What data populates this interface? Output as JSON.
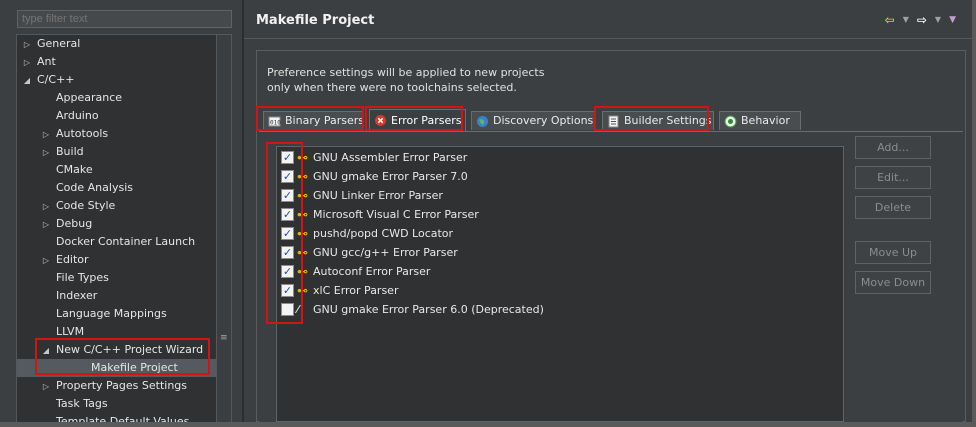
{
  "filter": {
    "placeholder": "type filter text"
  },
  "tree": [
    {
      "label": "General",
      "twisty": "collapsed",
      "indent": 0
    },
    {
      "label": "Ant",
      "twisty": "collapsed",
      "indent": 0
    },
    {
      "label": "C/C++",
      "twisty": "expanded",
      "indent": 0
    },
    {
      "label": "Appearance",
      "twisty": "none",
      "indent": 1
    },
    {
      "label": "Arduino",
      "twisty": "none",
      "indent": 1
    },
    {
      "label": "Autotools",
      "twisty": "collapsed",
      "indent": 1
    },
    {
      "label": "Build",
      "twisty": "collapsed",
      "indent": 1
    },
    {
      "label": "CMake",
      "twisty": "none",
      "indent": 1
    },
    {
      "label": "Code Analysis",
      "twisty": "none",
      "indent": 1
    },
    {
      "label": "Code Style",
      "twisty": "collapsed",
      "indent": 1
    },
    {
      "label": "Debug",
      "twisty": "collapsed",
      "indent": 1
    },
    {
      "label": "Docker Container Launch",
      "twisty": "none",
      "indent": 1
    },
    {
      "label": "Editor",
      "twisty": "collapsed",
      "indent": 1
    },
    {
      "label": "File Types",
      "twisty": "none",
      "indent": 1
    },
    {
      "label": "Indexer",
      "twisty": "none",
      "indent": 1
    },
    {
      "label": "Language Mappings",
      "twisty": "none",
      "indent": 1
    },
    {
      "label": "LLVM",
      "twisty": "none",
      "indent": 1
    },
    {
      "label": "New C/C++ Project Wizard",
      "twisty": "expanded",
      "indent": 1
    },
    {
      "label": "Makefile Project",
      "twisty": "none",
      "indent": 2,
      "selected": true
    },
    {
      "label": "Property Pages Settings",
      "twisty": "collapsed",
      "indent": 1
    },
    {
      "label": "Task Tags",
      "twisty": "none",
      "indent": 1
    },
    {
      "label": "Template Default Values",
      "twisty": "none",
      "indent": 1
    }
  ],
  "header": {
    "title": "Makefile Project"
  },
  "info": {
    "line1": "Preference settings will be applied to new projects",
    "line2": "only when there were no toolchains selected."
  },
  "tabs": [
    {
      "label": "Binary Parsers",
      "icon": "binary-icon"
    },
    {
      "label": "Error Parsers",
      "icon": "error-icon"
    },
    {
      "label": "Discovery Options",
      "icon": "globe-icon"
    },
    {
      "label": "Builder Settings",
      "icon": "settings-doc-icon"
    },
    {
      "label": "Behavior",
      "icon": "radio-icon"
    }
  ],
  "active_tab": "Error Parsers",
  "parsers": [
    {
      "label": "GNU Assembler Error Parser",
      "checked": true
    },
    {
      "label": "GNU gmake Error Parser 7.0",
      "checked": true
    },
    {
      "label": "GNU Linker Error Parser",
      "checked": true
    },
    {
      "label": "Microsoft Visual C Error Parser",
      "checked": true
    },
    {
      "label": "pushd/popd CWD Locator",
      "checked": true
    },
    {
      "label": "GNU gcc/g++ Error Parser",
      "checked": true
    },
    {
      "label": "Autoconf Error Parser",
      "checked": true
    },
    {
      "label": "xlC Error Parser",
      "checked": true
    },
    {
      "label": "GNU gmake Error Parser 6.0 (Deprecated)",
      "checked": false
    }
  ],
  "buttons": {
    "add": "Add...",
    "edit": "Edit...",
    "delete": "Delete",
    "move_up": "Move Up",
    "move_down": "Move Down"
  },
  "colors": {
    "highlight": "#d11414",
    "background": "#3c3f41",
    "list_bg": "#2f3133"
  }
}
